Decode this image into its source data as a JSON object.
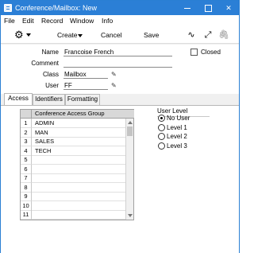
{
  "window": {
    "title": "Conference/Mailbox: New"
  },
  "menu": [
    "File",
    "Edit",
    "Record",
    "Window",
    "Info"
  ],
  "toolbar": {
    "create": "Create",
    "cancel": "Cancel",
    "save": "Save"
  },
  "form": {
    "name_label": "Name",
    "name_value": "Francoise French",
    "comment_label": "Comment",
    "comment_value": "",
    "class_label": "Class",
    "class_value": "Mailbox",
    "user_label": "User",
    "user_value": "FF",
    "closed_label": "Closed",
    "closed_checked": false
  },
  "tabs": [
    "Access",
    "Identifiers",
    "Formatting"
  ],
  "active_tab": "Access",
  "access_grid": {
    "header": "Conference Access Group",
    "rows": [
      {
        "n": "1",
        "v": "ADMIN"
      },
      {
        "n": "2",
        "v": "MAN"
      },
      {
        "n": "3",
        "v": "SALES"
      },
      {
        "n": "4",
        "v": "TECH"
      },
      {
        "n": "5",
        "v": ""
      },
      {
        "n": "6",
        "v": ""
      },
      {
        "n": "7",
        "v": ""
      },
      {
        "n": "8",
        "v": ""
      },
      {
        "n": "9",
        "v": ""
      },
      {
        "n": "10",
        "v": ""
      },
      {
        "n": "11",
        "v": ""
      }
    ]
  },
  "user_level": {
    "title": "User Level",
    "options": [
      "No User",
      "Level 1",
      "Level 2",
      "Level 3"
    ],
    "selected": "No User"
  },
  "icons": [
    "app-icon",
    "gear-icon",
    "wave-icon",
    "expand-icon",
    "paperclip-icon",
    "pencil-icon"
  ]
}
